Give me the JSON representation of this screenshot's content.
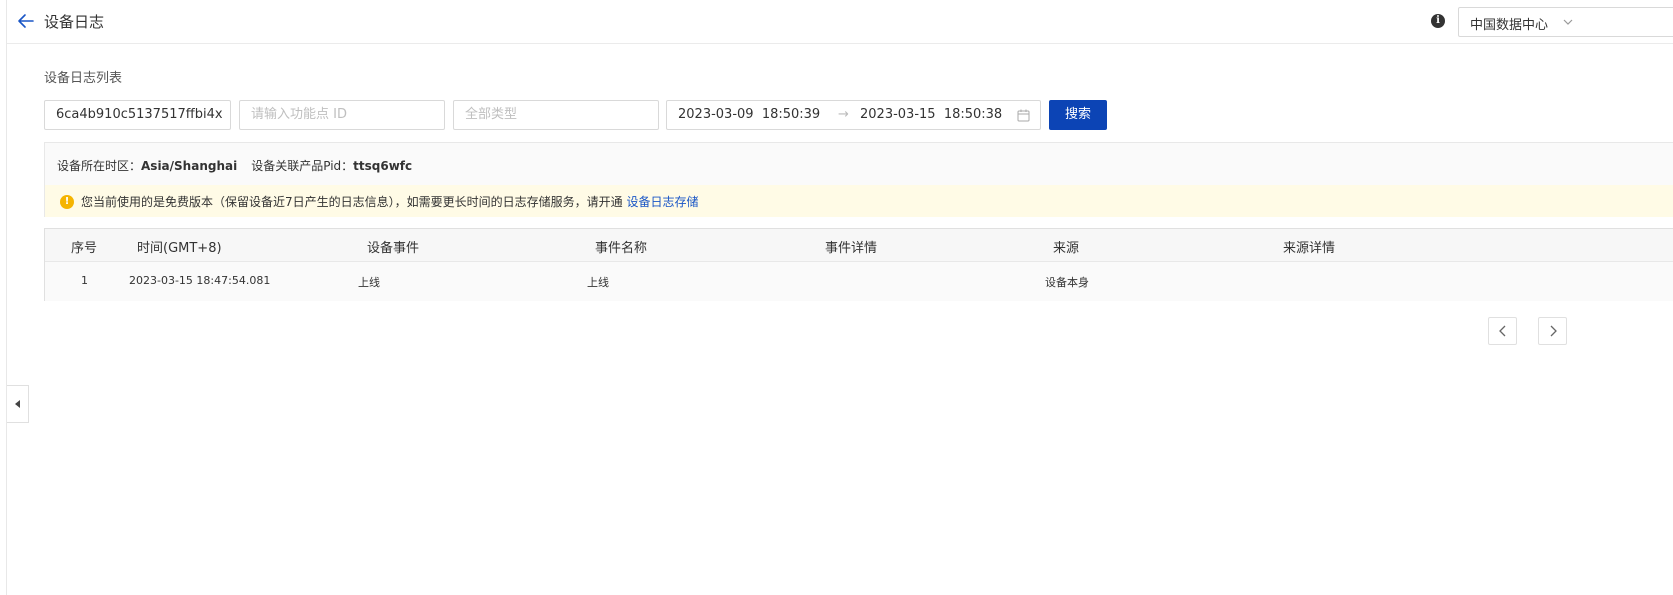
{
  "header": {
    "title": "设备日志",
    "back_icon": "arrow-left-icon",
    "info_icon": "info-icon",
    "region": "中国数据中心"
  },
  "section_title": "设备日志列表",
  "filters": {
    "device_id_value": "6ca4b910c5137517ffbi4x",
    "function_id_placeholder": "请输入功能点 ID",
    "type_placeholder": "全部类型",
    "date_start": "2023-03-09  18:50:39",
    "date_arrow": "→",
    "date_end": "2023-03-15  18:50:38",
    "search_label": "搜索"
  },
  "info": {
    "tz_label": "设备所在时区：",
    "tz_value": "Asia/Shanghai",
    "pid_label": "设备关联产品Pid：",
    "pid_value": "ttsq6wfc",
    "notice_text": "您当前使用的是免费版本（保留设备近7日产生的日志信息），如需要更长时间的日志存储服务，请开通",
    "notice_link": "设备日志存储"
  },
  "table": {
    "headers": [
      "序号",
      "时间(GMT+8)",
      "设备事件",
      "事件名称",
      "事件详情",
      "来源",
      "来源详情"
    ],
    "rows": [
      [
        "1",
        "2023-03-15 18:47:54.081",
        "上线",
        "上线",
        "",
        "设备本身",
        ""
      ]
    ]
  },
  "colors": {
    "primary": "#0c44b5",
    "link": "#1a56c6",
    "warning": "#f5b400",
    "notice_bg": "#fffbe6"
  }
}
